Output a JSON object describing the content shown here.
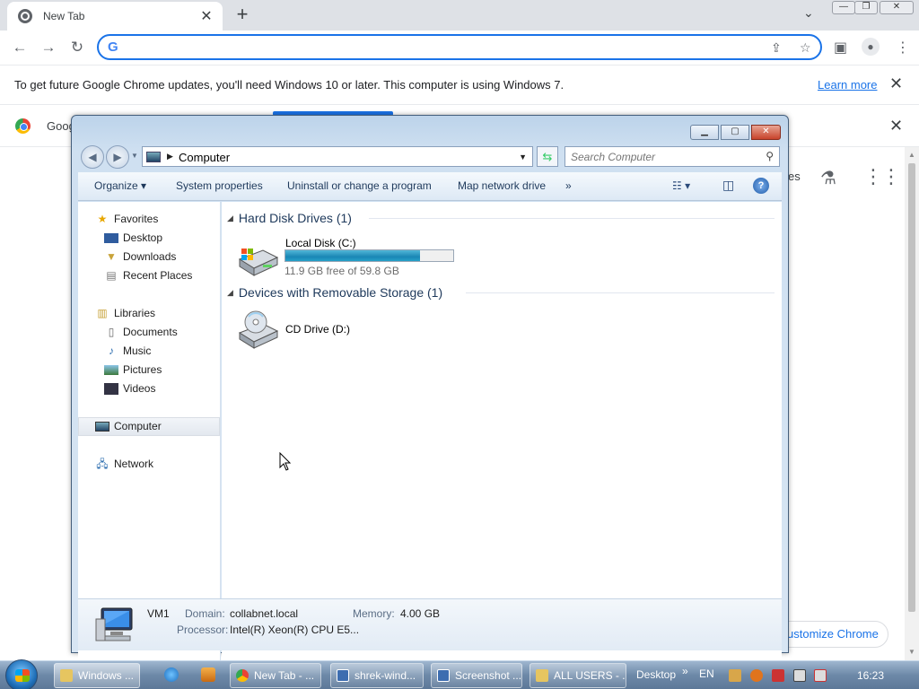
{
  "browser": {
    "tab_title": "New Tab",
    "tab_close": "✕",
    "new_tab": "+",
    "omnibox_value": "",
    "omnibox_logo": "G",
    "infobar_message": "To get future Google Chrome updates, you'll need Windows 10 or later. This computer is using Windows 7.",
    "infobar_link": "Learn more",
    "bookmark_label": "Goog",
    "ntp_partial_text": "es",
    "customize_label": "ustomize Chrome"
  },
  "explorer": {
    "address_path": "Computer",
    "search_placeholder": "Search Computer",
    "commands": [
      "Organize ▾",
      "System properties",
      "Uninstall or change a program",
      "Map network drive",
      "»"
    ],
    "nav": {
      "favorites": "Favorites",
      "desktop": "Desktop",
      "downloads": "Downloads",
      "recent": "Recent Places",
      "libraries": "Libraries",
      "documents": "Documents",
      "music": "Music",
      "pictures": "Pictures",
      "videos": "Videos",
      "computer": "Computer",
      "network": "Network"
    },
    "groups": {
      "hdd_title": "Hard Disk Drives (1)",
      "removable_title": "Devices with Removable Storage (1)"
    },
    "drives": {
      "c_name": "Local Disk (C:)",
      "c_free": "11.9 GB free of 59.8 GB",
      "c_used_fraction": 0.8,
      "d_name": "CD Drive (D:)"
    },
    "details": {
      "name": "VM1",
      "domain_label": "Domain:",
      "domain_value": "collabnet.local",
      "memory_label": "Memory:",
      "memory_value": "4.00 GB",
      "processor_label": "Processor:",
      "processor_value": "Intel(R) Xeon(R) CPU E5..."
    }
  },
  "taskbar": {
    "buttons": [
      "Windows ...",
      "New Tab - ...",
      "shrek-wind...",
      "Screenshot ...",
      "ALL USERS - ..."
    ],
    "desktop_label": "Desktop",
    "chevron": "»",
    "language": "EN",
    "clock": "16:23"
  },
  "colors": {
    "chrome_accent": "#1a73e8",
    "explorer_frame": "#bcd3ea",
    "drive_bar": "#26a0c8",
    "taskbar": "#6d89a8"
  }
}
